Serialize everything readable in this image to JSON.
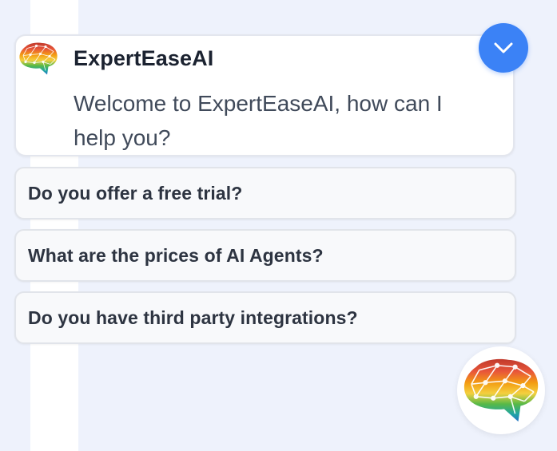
{
  "header": {
    "bot_name": "ExpertEaseAI",
    "welcome_message": "Welcome to ExpertEaseAI, how can I help you?"
  },
  "suggestions": [
    {
      "label": "Do you offer a free trial?"
    },
    {
      "label": "What are the prices of AI Agents?"
    },
    {
      "label": "Do you have third party integrations?"
    }
  ],
  "icons": {
    "collapse": "chevron-down-icon",
    "logo": "brain-logo-icon"
  },
  "colors": {
    "accent": "#3b82f6",
    "background": "#eef2fc",
    "card": "#ffffff"
  }
}
